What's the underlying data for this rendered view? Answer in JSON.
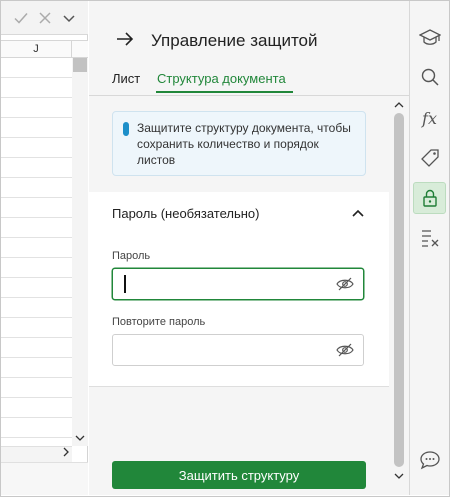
{
  "spreadsheet": {
    "column_label": "J",
    "formula_icons": [
      "checkmark-icon",
      "close-icon",
      "chevron-down-icon"
    ]
  },
  "panel": {
    "title": "Управление защитой",
    "tabs": [
      {
        "label": "Лист",
        "active": false
      },
      {
        "label": "Структура документа",
        "active": true
      }
    ],
    "info_text": "Защитите структуру документа, чтобы сохранить количество и порядок листов",
    "password_section": {
      "heading": "Пароль (необязательно)",
      "expanded": true,
      "password_label": "Пароль",
      "password_value": "",
      "repeat_label": "Повторите пароль",
      "repeat_value": ""
    },
    "primary_button": "Защитить структуру"
  },
  "sidebar_icons": [
    {
      "icon": "graduation-cap-icon",
      "active": false
    },
    {
      "icon": "search-icon",
      "active": false
    },
    {
      "icon": "function-icon",
      "active": false
    },
    {
      "icon": "tag-icon",
      "active": false
    },
    {
      "icon": "lock-icon",
      "active": true
    },
    {
      "icon": "checklist-icon",
      "active": false
    },
    {
      "icon": "chat-icon",
      "active": false
    }
  ],
  "colors": {
    "accent": "#21873a",
    "info_dot": "#1d8fc9",
    "info_bg": "#eef6fb",
    "active_icon_bg": "#d8ecd9"
  }
}
